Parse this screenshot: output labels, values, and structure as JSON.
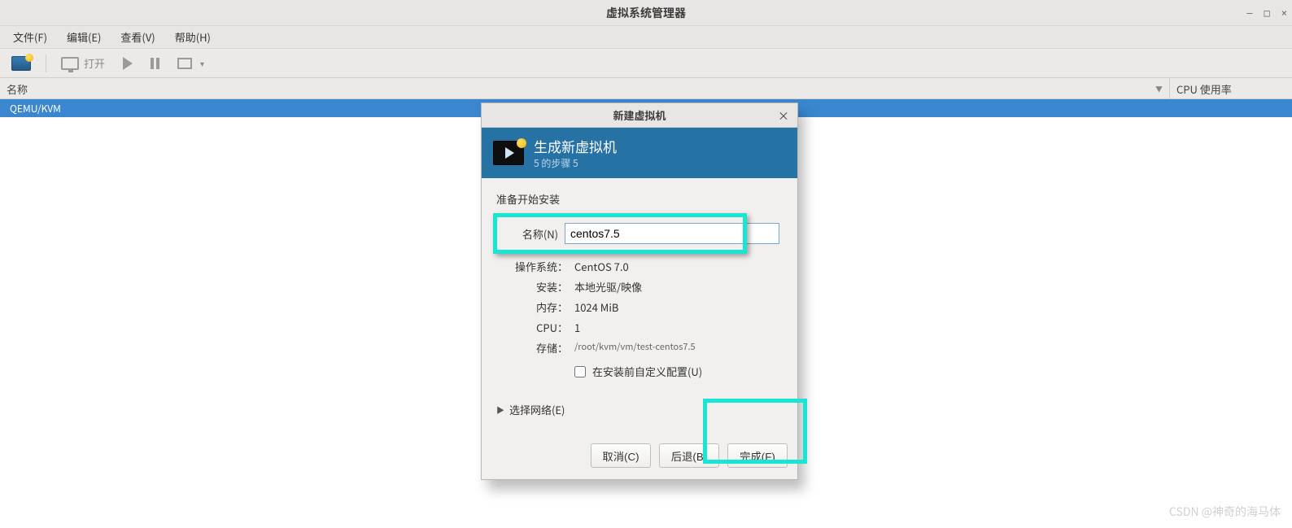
{
  "window": {
    "title": "虚拟系统管理器",
    "controls": {
      "minimize": "—",
      "maximize": "□",
      "close": "×"
    }
  },
  "menubar": {
    "file": "文件(F)",
    "edit": "编辑(E)",
    "view": "查看(V)",
    "help": "帮助(H)"
  },
  "toolbar": {
    "open_label": "打开"
  },
  "headers": {
    "name": "名称",
    "cpu": "CPU 使用率"
  },
  "tree": {
    "hypervisor": "QEMU/KVM"
  },
  "dialog": {
    "title": "新建虚拟机",
    "header_title": "生成新虚拟机",
    "step_label": "5 的步骤 5",
    "prepare_label": "准备开始安装",
    "name_label": "名称(N)",
    "name_value": "centos7.5",
    "os_label": "操作系统：",
    "os_value": "CentOS 7.0",
    "install_label": "安装：",
    "install_value": "本地光驱/映像",
    "memory_label": "内存：",
    "memory_value": "1024 MiB",
    "cpu_label": "CPU：",
    "cpu_value": "1",
    "storage_label": "存储：",
    "storage_value": "/root/kvm/vm/test-centos7.5",
    "customize_label": "在安装前自定义配置(U)",
    "network_expander": "选择网络(E)",
    "cancel": "取消(C)",
    "back": "后退(B)",
    "finish": "完成(F)"
  },
  "watermark": "CSDN @神奇的海马体"
}
